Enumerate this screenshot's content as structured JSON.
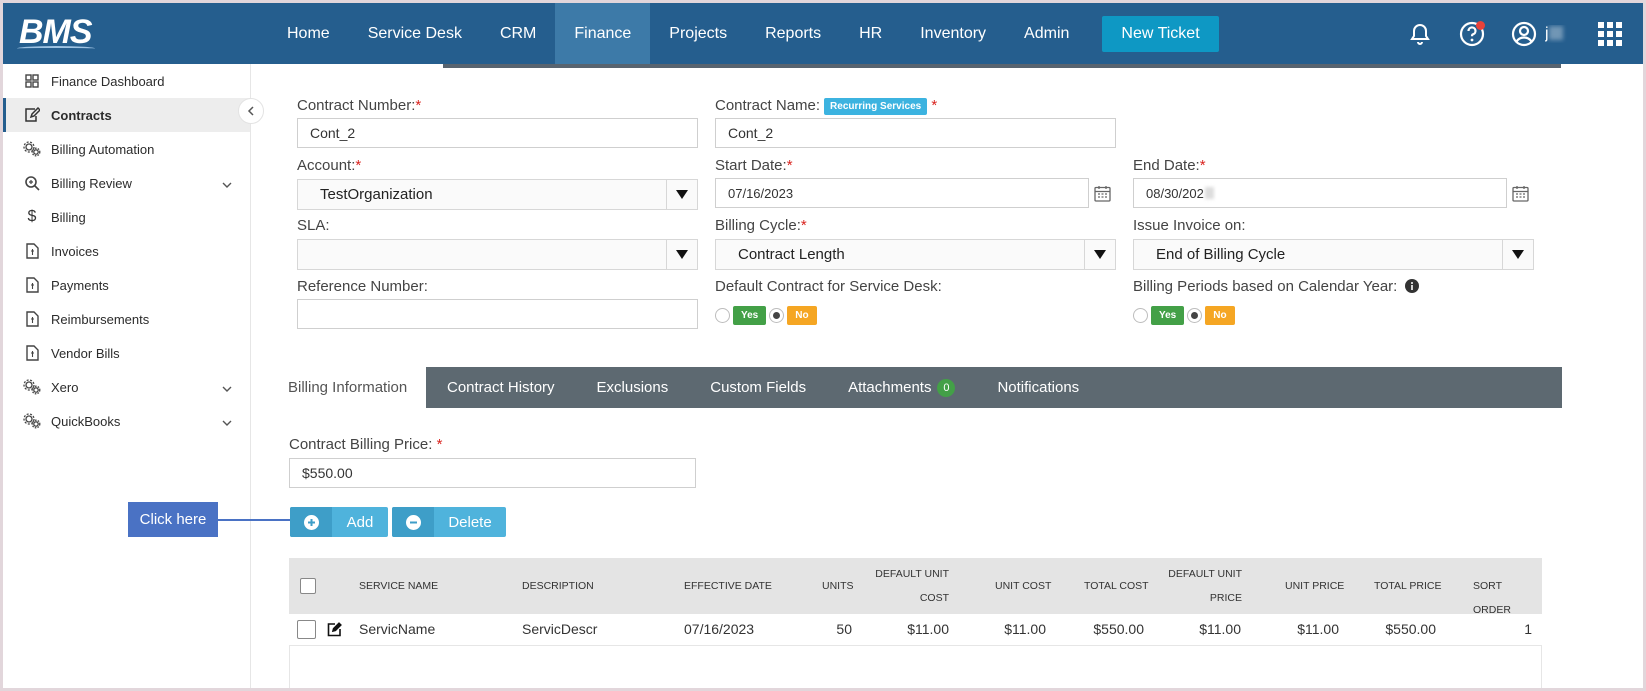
{
  "app": {
    "logo": "BMS",
    "username": "j"
  },
  "nav": {
    "items": [
      "Home",
      "Service Desk",
      "CRM",
      "Finance",
      "Projects",
      "Reports",
      "HR",
      "Inventory",
      "Admin"
    ],
    "active": "Finance",
    "new_ticket": "New Ticket",
    "icons": [
      "bell-icon",
      "help-icon",
      "user-icon",
      "apps-grid-icon"
    ]
  },
  "sidebar": {
    "items": [
      {
        "label": "Finance Dashboard",
        "icon": "dashboard-icon"
      },
      {
        "label": "Contracts",
        "icon": "contract-edit-icon",
        "active": true
      },
      {
        "label": "Billing Automation",
        "icon": "gears-icon"
      },
      {
        "label": "Billing Review",
        "icon": "search-icon",
        "expandable": true
      },
      {
        "label": "Billing",
        "icon": "dollar-icon"
      },
      {
        "label": "Invoices",
        "icon": "document-icon"
      },
      {
        "label": "Payments",
        "icon": "document-icon"
      },
      {
        "label": "Reimbursements",
        "icon": "document-icon"
      },
      {
        "label": "Vendor Bills",
        "icon": "document-icon"
      },
      {
        "label": "Xero",
        "icon": "gears-icon",
        "expandable": true
      },
      {
        "label": "QuickBooks",
        "icon": "gears-icon",
        "expandable": true
      }
    ]
  },
  "form": {
    "contract_number": {
      "label": "Contract Number:",
      "required": "*",
      "value": "Cont_2"
    },
    "contract_name": {
      "label": "Contract Name:",
      "badge": "Recurring Services",
      "required": "*",
      "value": "Cont_2"
    },
    "account": {
      "label": "Account:",
      "required": "*",
      "value": "TestOrganization"
    },
    "start_date": {
      "label": "Start Date:",
      "required": "*",
      "value": "07/16/2023"
    },
    "end_date": {
      "label": "End Date:",
      "required": "*",
      "value": "08/30/202"
    },
    "sla": {
      "label": "SLA:",
      "value": ""
    },
    "billing_cycle": {
      "label": "Billing Cycle:",
      "required": "*",
      "value": "Contract Length"
    },
    "issue_invoice": {
      "label": "Issue Invoice on:",
      "value": "End of Billing Cycle"
    },
    "reference_number": {
      "label": "Reference Number:",
      "value": ""
    },
    "default_contract": {
      "label": "Default Contract for Service Desk:",
      "yes": "Yes",
      "no": "No",
      "selected": "No"
    },
    "billing_periods": {
      "label": "Billing Periods based on Calendar Year:",
      "yes": "Yes",
      "no": "No",
      "selected": "No"
    }
  },
  "tabs": {
    "items": [
      "Billing Information",
      "Contract History",
      "Exclusions",
      "Custom Fields",
      "Attachments",
      "Notifications"
    ],
    "active": "Billing Information",
    "attachments_count": "0"
  },
  "billing": {
    "price_label": "Contract Billing Price:",
    "required": "*",
    "price_value": "$550.00",
    "add_label": "Add",
    "delete_label": "Delete",
    "callout": "Click here"
  },
  "table": {
    "headers": [
      "SERVICE NAME",
      "DESCRIPTION",
      "EFFECTIVE DATE",
      "UNITS",
      "DEFAULT UNIT COST",
      "UNIT COST",
      "TOTAL COST",
      "DEFAULT UNIT PRICE",
      "UNIT PRICE",
      "TOTAL PRICE",
      "SORT ORDER"
    ],
    "header_lines": {
      "default_unit_cost": [
        "DEFAULT UNIT",
        "COST"
      ],
      "default_unit_price": [
        "DEFAULT UNIT",
        "PRICE"
      ]
    },
    "rows": [
      {
        "service_name": "ServicName",
        "description": "ServicDescr",
        "effective_date": "07/16/2023",
        "units": "50",
        "default_unit_cost": "$11.00",
        "unit_cost": "$11.00",
        "total_cost": "$550.00",
        "default_unit_price": "$11.00",
        "unit_price": "$11.00",
        "total_price": "$550.00",
        "sort_order": "1"
      }
    ]
  }
}
